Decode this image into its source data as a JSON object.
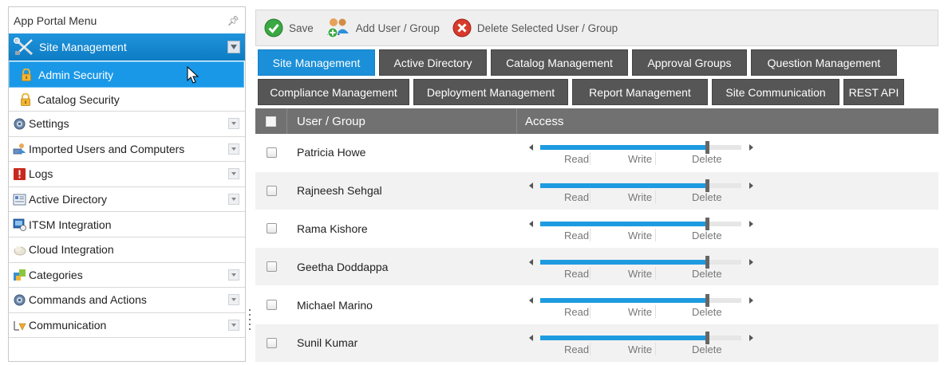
{
  "menu": {
    "title": "App Portal Menu",
    "pin_glyph": "ф",
    "section": {
      "label": "Site Management",
      "icon": "tools-icon"
    },
    "active_item": "Admin Security",
    "second_item": "Catalog Security",
    "items": [
      {
        "label": "Settings",
        "icon": "gear-icon",
        "expandable": true
      },
      {
        "label": "Imported Users and Computers",
        "icon": "users-computers-icon",
        "expandable": true
      },
      {
        "label": "Logs",
        "icon": "log-alert-icon",
        "expandable": true
      },
      {
        "label": "Active Directory",
        "icon": "directory-icon",
        "expandable": true
      },
      {
        "label": "ITSM Integration",
        "icon": "itsm-icon",
        "expandable": false
      },
      {
        "label": "Cloud Integration",
        "icon": "cloud-icon",
        "expandable": false
      },
      {
        "label": "Categories",
        "icon": "categories-icon",
        "expandable": true
      },
      {
        "label": "Commands and Actions",
        "icon": "gear-icon",
        "expandable": true
      },
      {
        "label": "Communication",
        "icon": "communication-icon",
        "expandable": true
      }
    ]
  },
  "toolbar": {
    "save": "Save",
    "add": "Add User / Group",
    "delete": "Delete Selected User / Group"
  },
  "tabs": {
    "row1": [
      "Site Management",
      "Active Directory",
      "Catalog Management",
      "Approval Groups",
      "Question Management"
    ],
    "row2": [
      "Compliance Management",
      "Deployment Management",
      "Report Management",
      "Site Communication",
      "REST API"
    ],
    "active": "Site Management"
  },
  "grid": {
    "col_user": "User / Group",
    "col_access": "Access",
    "access_levels": [
      "Read",
      "Write",
      "Delete"
    ],
    "rows": [
      {
        "name": "Patricia Howe",
        "access": "Delete"
      },
      {
        "name": "Rajneesh Sehgal",
        "access": "Delete"
      },
      {
        "name": "Rama Kishore",
        "access": "Delete"
      },
      {
        "name": "Geetha Doddappa",
        "access": "Delete"
      },
      {
        "name": "Michael Marino",
        "access": "Delete"
      },
      {
        "name": "Sunil Kumar",
        "access": "Delete"
      }
    ]
  },
  "colors": {
    "accent": "#1b8fd8",
    "selected_item": "#1a98e8",
    "tab_inactive": "#565656",
    "grid_header": "#717171",
    "save_green": "#3aa843",
    "delete_red": "#d83a2c"
  }
}
